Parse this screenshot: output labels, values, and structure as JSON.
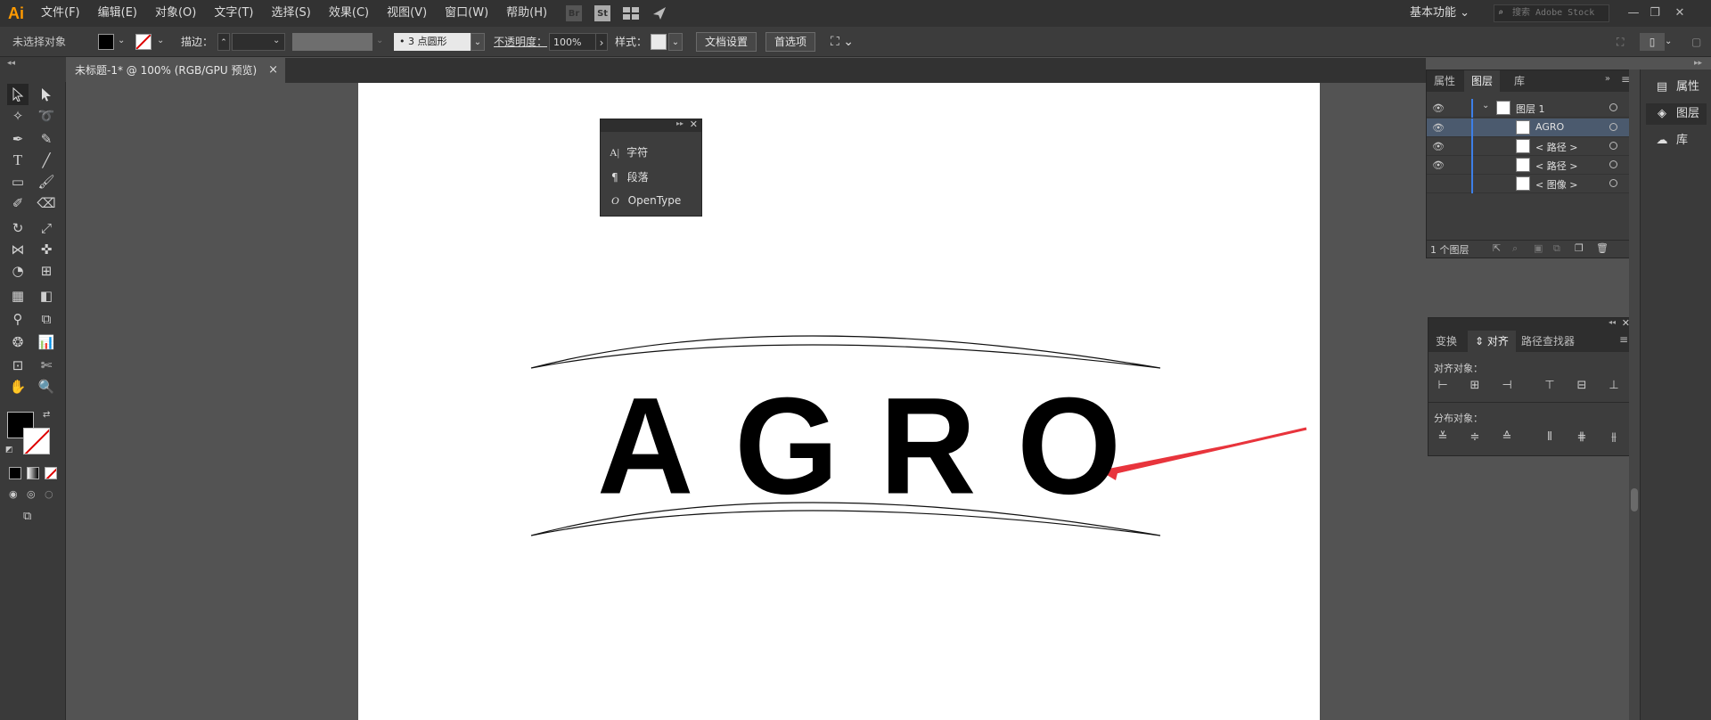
{
  "app": {
    "logo": "Ai"
  },
  "menu": [
    "文件(F)",
    "编辑(E)",
    "对象(O)",
    "文字(T)",
    "选择(S)",
    "效果(C)",
    "视图(V)",
    "窗口(W)",
    "帮助(H)"
  ],
  "menu_icons": {
    "br": "Br",
    "st": "St"
  },
  "workspace": "基本功能",
  "stock_search_placeholder": "搜索 Adobe Stock",
  "control": {
    "selection_status": "未选择对象",
    "stroke_label": "描边：",
    "brush_value": "3 点圆形",
    "opacity_label": "不透明度：",
    "opacity_value": "100%",
    "style_label": "样式：",
    "doc_setup": "文档设置",
    "preferences": "首选项"
  },
  "doc_tab": {
    "title": "未标题-1* @ 100% (RGB/GPU 预览)",
    "close": "×"
  },
  "type_panel": {
    "items": [
      "字符",
      "段落",
      "OpenType"
    ]
  },
  "layers_panel": {
    "tabs": [
      "属性",
      "图层",
      "库"
    ],
    "layers": [
      {
        "name": "图层 1",
        "selected": false
      },
      {
        "name": "AGRO",
        "selected": true
      },
      {
        "name": "< 路径 >",
        "selected": false
      },
      {
        "name": "< 路径 >",
        "selected": false
      },
      {
        "name": "< 图像 >",
        "selected": false
      }
    ],
    "footer": "1 个图层"
  },
  "align_panel": {
    "tabs": [
      "变换",
      "对齐",
      "路径查找器"
    ],
    "align_objects_label": "对齐对象：",
    "distribute_objects_label": "分布对象："
  },
  "right_dock": [
    "属性",
    "图层",
    "库"
  ],
  "artwork": {
    "word": "AGRO"
  },
  "colors": {
    "accent_arrow": "#e8343c",
    "selection_blue": "#3d7fe8",
    "logo": "#ff9a00"
  }
}
